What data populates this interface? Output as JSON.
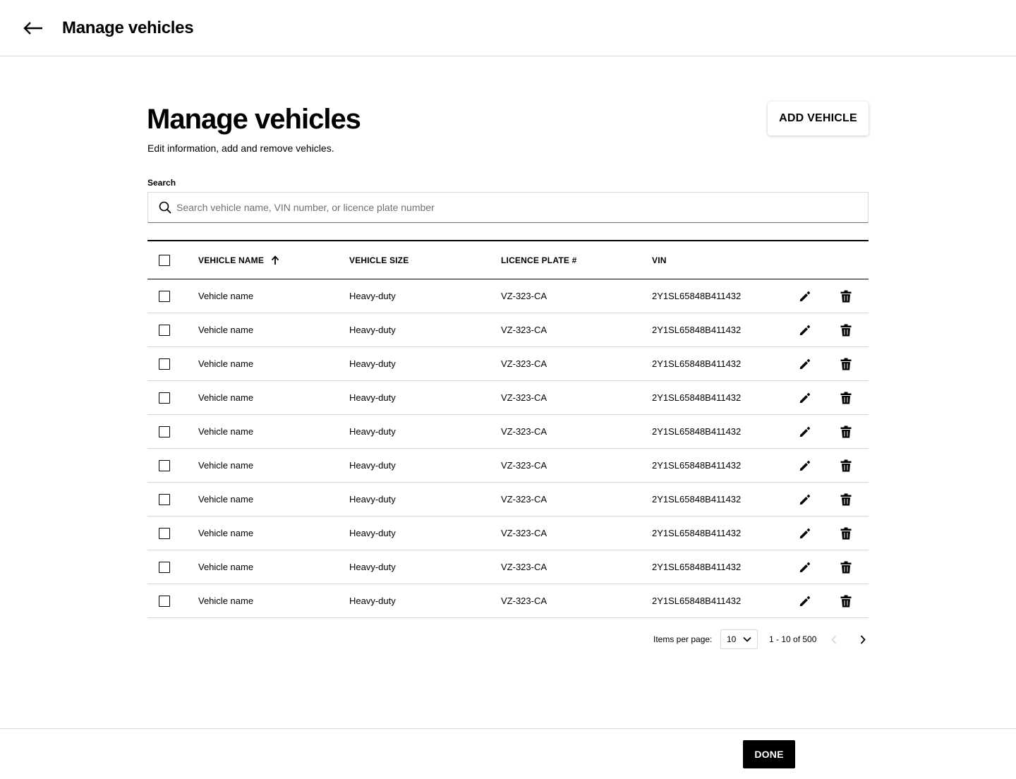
{
  "header": {
    "back_icon": "arrow-left-icon",
    "title": "Manage vehicles"
  },
  "main": {
    "title": "Manage vehicles",
    "subtitle": "Edit information, add and remove vehicles.",
    "add_button_label": "ADD VEHICLE"
  },
  "search": {
    "label": "Search",
    "placeholder": "Search vehicle name, VIN number, or licence plate number",
    "value": "",
    "icon": "search-icon"
  },
  "table": {
    "columns": [
      "VEHICLE NAME",
      "VEHICLE SIZE",
      "LICENCE PLATE #",
      "VIN"
    ],
    "sort": {
      "column": "VEHICLE NAME",
      "direction": "ascending",
      "icon": "arrow-up-icon"
    },
    "row_actions": {
      "edit_icon": "pencil-icon",
      "delete_icon": "trash-icon"
    },
    "rows": [
      {
        "name": "Vehicle name",
        "size": "Heavy-duty",
        "plate": "VZ-323-CA",
        "vin": "2Y1SL65848B411432",
        "checked": false
      },
      {
        "name": "Vehicle name",
        "size": "Heavy-duty",
        "plate": "VZ-323-CA",
        "vin": "2Y1SL65848B411432",
        "checked": false
      },
      {
        "name": "Vehicle name",
        "size": "Heavy-duty",
        "plate": "VZ-323-CA",
        "vin": "2Y1SL65848B411432",
        "checked": false
      },
      {
        "name": "Vehicle name",
        "size": "Heavy-duty",
        "plate": "VZ-323-CA",
        "vin": "2Y1SL65848B411432",
        "checked": false
      },
      {
        "name": "Vehicle name",
        "size": "Heavy-duty",
        "plate": "VZ-323-CA",
        "vin": "2Y1SL65848B411432",
        "checked": false
      },
      {
        "name": "Vehicle name",
        "size": "Heavy-duty",
        "plate": "VZ-323-CA",
        "vin": "2Y1SL65848B411432",
        "checked": false
      },
      {
        "name": "Vehicle name",
        "size": "Heavy-duty",
        "plate": "VZ-323-CA",
        "vin": "2Y1SL65848B411432",
        "checked": false
      },
      {
        "name": "Vehicle name",
        "size": "Heavy-duty",
        "plate": "VZ-323-CA",
        "vin": "2Y1SL65848B411432",
        "checked": false
      },
      {
        "name": "Vehicle name",
        "size": "Heavy-duty",
        "plate": "VZ-323-CA",
        "vin": "2Y1SL65848B411432",
        "checked": false
      },
      {
        "name": "Vehicle name",
        "size": "Heavy-duty",
        "plate": "VZ-323-CA",
        "vin": "2Y1SL65848B411432",
        "checked": false
      }
    ]
  },
  "pagination": {
    "items_per_page_label": "Items per page:",
    "items_per_page_value": "10",
    "range_text": "1 - 10 of 500",
    "prev_icon": "chevron-left-icon",
    "next_icon": "chevron-right-icon",
    "prev_disabled": true
  },
  "footer": {
    "done_label": "DONE"
  },
  "colors": {
    "text": "#000000",
    "border_light": "#d8dada",
    "placeholder": "#6f7171",
    "disabled_icon": "#d8dada",
    "primary_button_bg": "#000000",
    "primary_button_text": "#ffffff"
  }
}
